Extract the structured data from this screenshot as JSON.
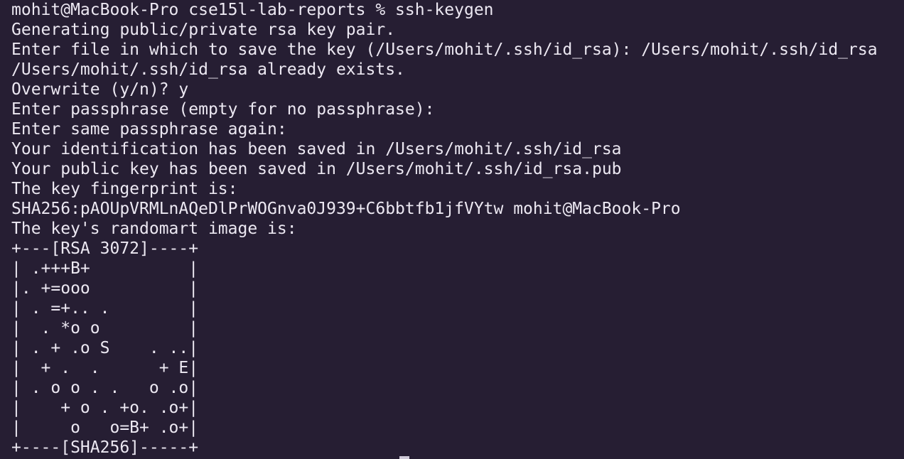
{
  "terminal": {
    "lines": [
      "mohit@MacBook-Pro cse15l-lab-reports % ssh-keygen",
      "Generating public/private rsa key pair.",
      "Enter file in which to save the key (/Users/mohit/.ssh/id_rsa): /Users/mohit/.ssh/id_rsa",
      "/Users/mohit/.ssh/id_rsa already exists.",
      "Overwrite (y/n)? y",
      "Enter passphrase (empty for no passphrase):",
      "Enter same passphrase again:",
      "Your identification has been saved in /Users/mohit/.ssh/id_rsa",
      "Your public key has been saved in /Users/mohit/.ssh/id_rsa.pub",
      "The key fingerprint is:",
      "SHA256:pAOUpVRMLnAQeDlPrWOGnva0J939+C6bbtfb1jfVYtw mohit@MacBook-Pro",
      "The key's randomart image is:",
      "+---[RSA 3072]----+",
      "| .+++B+          |",
      "|. +=ooo          |",
      "| . =+.. .        |",
      "|  . *o o         |",
      "| . + .o S    . ..|",
      "|  + .  .      + E|",
      "| . o o . .   o .o|",
      "|    + o . +o. .o+|",
      "|     o   o=B+ .o+|",
      "+----[SHA256]-----+"
    ],
    "colors": {
      "background": "#261e33",
      "foreground": "#ece8f2",
      "cursor": "#cfc9d8"
    }
  }
}
